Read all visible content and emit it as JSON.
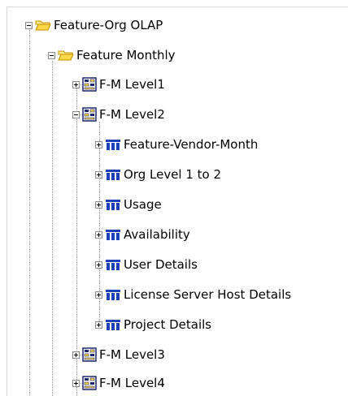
{
  "tree": {
    "root": {
      "label": "Feature-Org OLAP",
      "expanded": true,
      "icon": "folder-open-icon"
    },
    "monthly": {
      "label": "Feature Monthly",
      "expanded": true,
      "icon": "folder-open-icon"
    },
    "levels": [
      {
        "label": "F-M Level1",
        "expanded": false,
        "icon": "level-grid-icon"
      },
      {
        "label": "F-M Level2",
        "expanded": true,
        "icon": "level-grid-icon"
      },
      {
        "label": "F-M Level3",
        "expanded": false,
        "icon": "level-grid-icon"
      },
      {
        "label": "F-M Level4",
        "expanded": false,
        "icon": "level-grid-icon"
      }
    ],
    "level2_children": [
      {
        "label": "Feature-Vendor-Month",
        "expanded": false,
        "icon": "cube-table-icon"
      },
      {
        "label": "Org Level 1 to 2",
        "expanded": false,
        "icon": "cube-table-icon"
      },
      {
        "label": "Usage",
        "expanded": false,
        "icon": "cube-table-icon"
      },
      {
        "label": "Availability",
        "expanded": false,
        "icon": "cube-table-icon"
      },
      {
        "label": "User Details",
        "expanded": false,
        "icon": "cube-table-icon"
      },
      {
        "label": "License Server Host Details",
        "expanded": false,
        "icon": "cube-table-icon"
      },
      {
        "label": "Project Details",
        "expanded": false,
        "icon": "cube-table-icon"
      }
    ]
  },
  "colors": {
    "folder_fill": "#ffd84a",
    "folder_stroke": "#c09000",
    "level_icon_border": "#1f2a6b",
    "level_icon_fill": "#f5d24a",
    "cube_icon_blue": "#1d3fb8"
  }
}
